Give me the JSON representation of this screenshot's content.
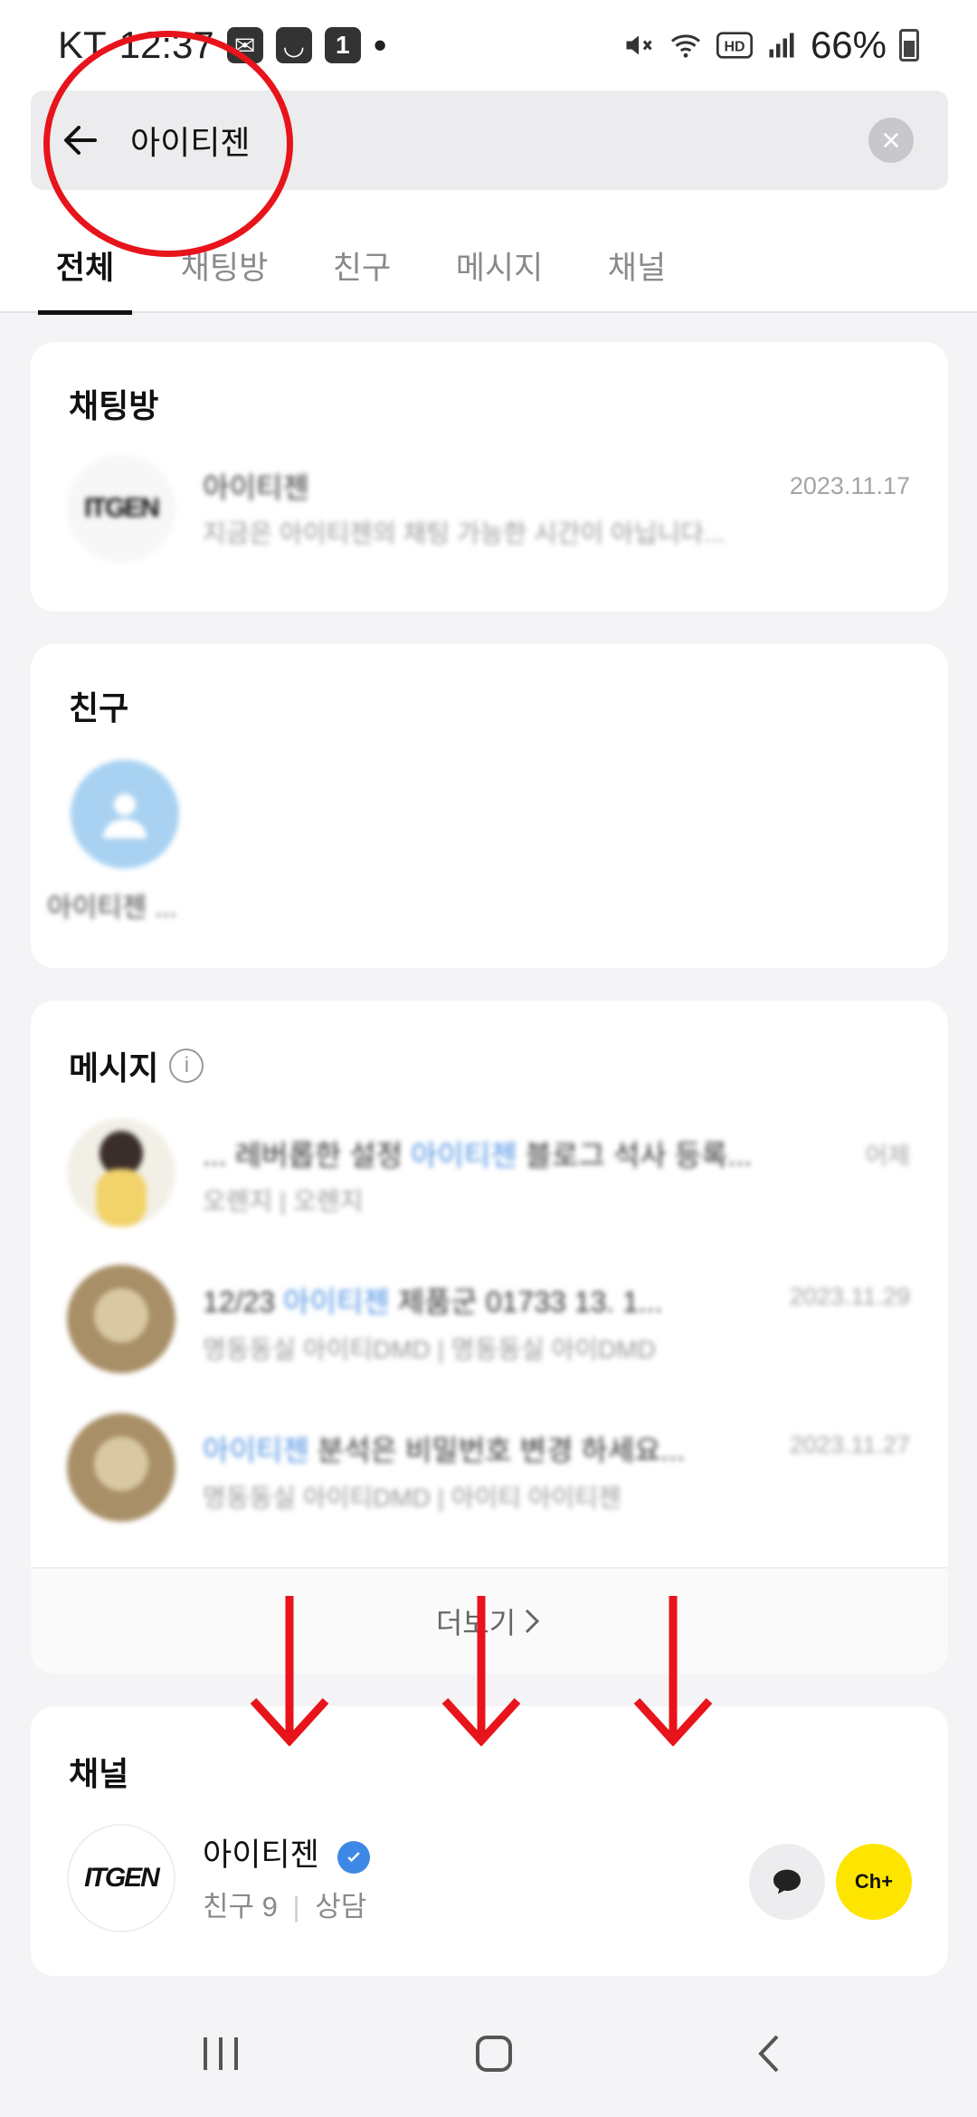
{
  "status_bar": {
    "carrier": "KT",
    "time": "12:37",
    "notif_badge": "1",
    "dot": "•",
    "battery": "66%"
  },
  "search": {
    "query": "아이티젠"
  },
  "tabs": [
    {
      "label": "전체",
      "active": true
    },
    {
      "label": "채팅방",
      "active": false
    },
    {
      "label": "친구",
      "active": false
    },
    {
      "label": "메시지",
      "active": false
    },
    {
      "label": "채널",
      "active": false
    }
  ],
  "chatroom_section": {
    "title": "채팅방",
    "item": {
      "name": "아이티젠",
      "preview": "지금은 아이티젠의 채팅 가능한 시간이 아닙니다...",
      "date": "2023.11.17"
    }
  },
  "friends_section": {
    "title": "친구",
    "friend": {
      "name": "아이티젠 ..."
    }
  },
  "messages_section": {
    "title": "메시지",
    "info_icon": "i",
    "items": [
      {
        "pre": "... 레버롭한 설정 ",
        "highlight": "아이티젠",
        "post": " 블로그 석사 등록...",
        "sub": "오렌지 | 오렌지",
        "date": "어제"
      },
      {
        "pre": "12/23 ",
        "highlight": "아이티젠",
        "post": " 제품군 01733 13. 1...",
        "sub": "명동동실 아이티DMD | 명동동실 아이DMD",
        "date": "2023.11.29"
      },
      {
        "pre": "",
        "highlight": "아이티젠",
        "post": " 분석은 비밀번호 변경 하세요...",
        "sub": "명동동실 아이티DMD | 아이티 아이티젠",
        "date": "2023.11.27"
      }
    ],
    "more_label": "더보기"
  },
  "channel_section": {
    "title": "채널",
    "channel": {
      "name": "아이티젠",
      "logo_text": "ITGEN",
      "friends_label": "친구 9",
      "separator": "|",
      "consult_label": "상담"
    },
    "chplus_label": "Ch+"
  },
  "annotations": {
    "circle_color": "#e8141b",
    "arrow_color": "#e8141b"
  }
}
